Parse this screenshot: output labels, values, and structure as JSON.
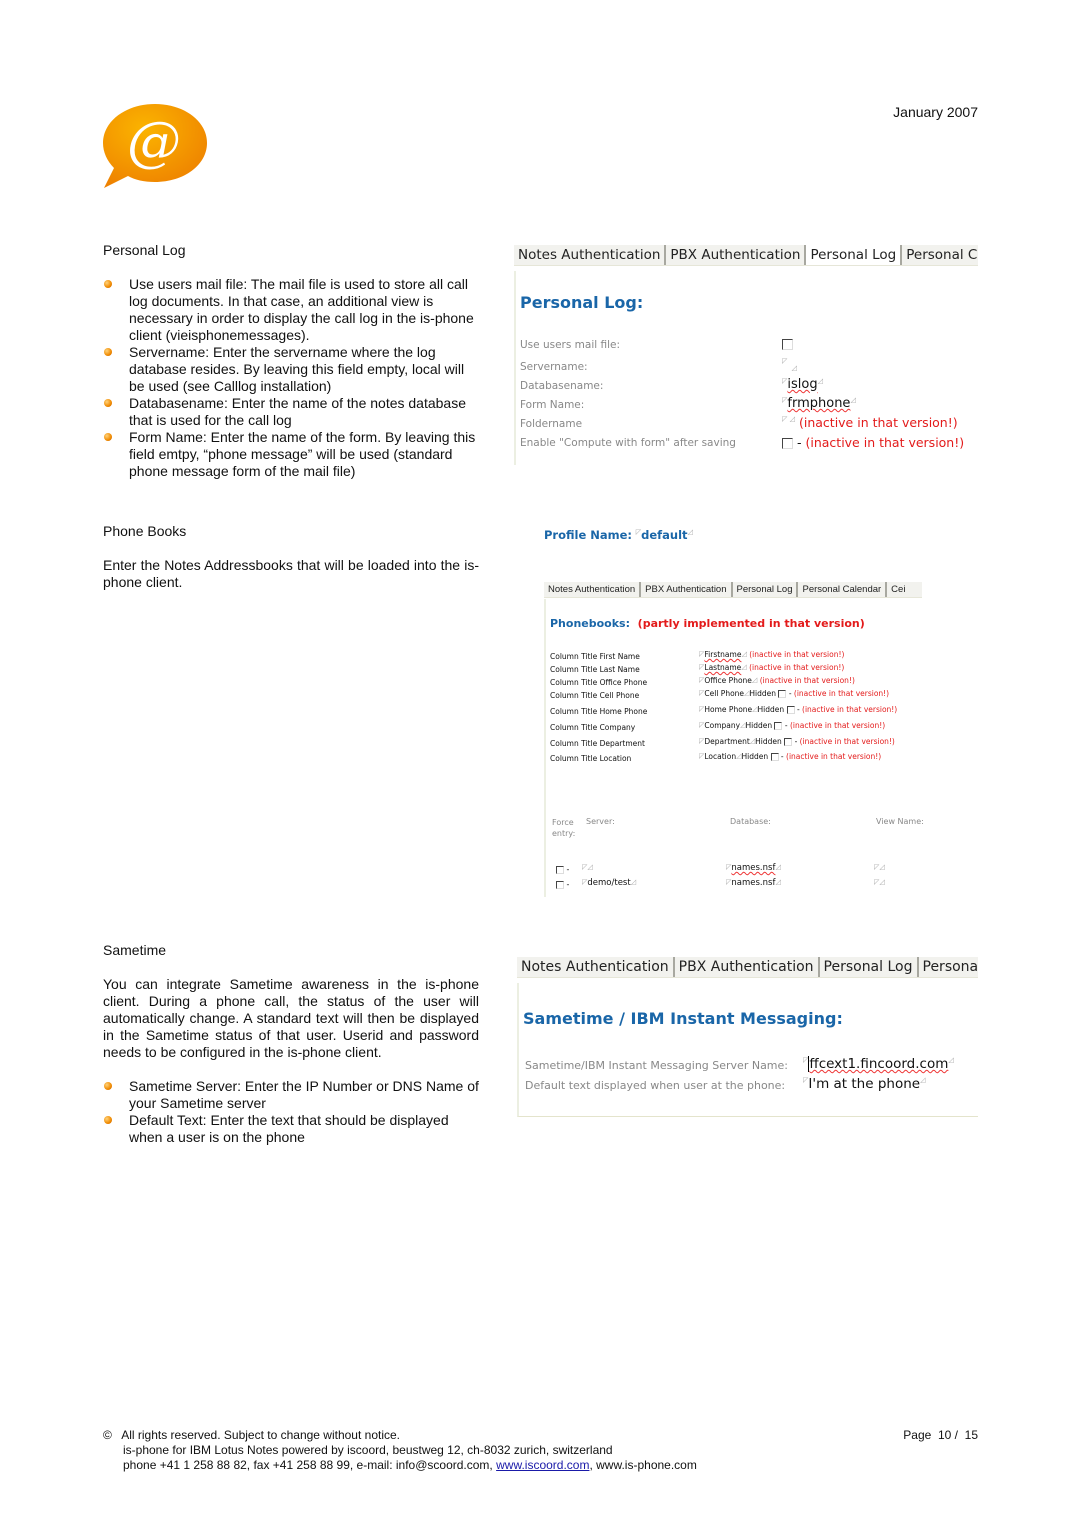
{
  "header": {
    "date": "January 2007",
    "logo_icon": "at-speech-bubble-icon",
    "logo_color": "#f39200"
  },
  "personal_log": {
    "heading": "Personal Log",
    "bullets": [
      "Use users mail file: The mail file is used to store all call log documents. In that case, an additional view is necessary in order to display the call log in the is-phone client (vieisphonemessages).",
      "Servername: Enter the servername where the log database resides. By leaving this field empty, local will be used (see Calllog installation)",
      "Databasename: Enter the name of the notes database that is used for the call log",
      "Form Name: Enter the name of the form. By leaving this field emtpy, “phone message” will be used (standard phone message form of the mail file)"
    ],
    "screenshot": {
      "tabs": [
        "Notes Authentication",
        "PBX Authentication",
        "Personal Log",
        "Personal Cale"
      ],
      "active_tab": 2,
      "title": "Personal Log:",
      "fields": [
        {
          "label": "Use users mail file:",
          "value": ""
        },
        {
          "label": "Servername:",
          "value": ""
        },
        {
          "label": "Databasename:",
          "value": "islog"
        },
        {
          "label": "Form Name:",
          "value": "frmphone"
        },
        {
          "label": "Foldername",
          "value": "",
          "note": "(inactive in that version!)"
        },
        {
          "label": "Enable \"Compute with form\" after saving",
          "value": "-",
          "note": "(inactive in that version!)"
        }
      ]
    }
  },
  "phone_books": {
    "heading": "Phone Books",
    "text": "Enter the Notes Addressbooks that will be loaded into the is-phone client.",
    "profile_label": "Profile Name:",
    "profile_value": "default",
    "screenshot": {
      "tabs": [
        "Notes Authentication",
        "PBX Authentication",
        "Personal Log",
        "Personal Calendar",
        "Cei"
      ],
      "title": "Phonebooks:",
      "title_note": "(partly implemented in that version)",
      "hidden_label": "Hidden",
      "note": "(inactive in that version!)",
      "columns": [
        {
          "label": "Column Title First Name",
          "value": "Firstname",
          "hidden": false
        },
        {
          "label": "Column Title Last Name",
          "value": "Lastname",
          "hidden": false
        },
        {
          "label": "Column Title Office Phone",
          "value": "Office Phone",
          "hidden": false
        },
        {
          "label": "Column Title Cell Phone",
          "value": "Cell Phone",
          "hidden": true
        },
        {
          "label": "Column Title Home Phone",
          "value": "Home Phone",
          "hidden": true
        },
        {
          "label": "Column Title Company",
          "value": "Company",
          "hidden": true
        },
        {
          "label": "Column Title Department",
          "value": "Department",
          "hidden": true
        },
        {
          "label": "Column Title Location",
          "value": "Location",
          "hidden": true
        }
      ],
      "table_headers": [
        "Force entry:",
        "Server:",
        "Database:",
        "View Name:"
      ],
      "table_rows": [
        {
          "server": "",
          "database": "names.nsf",
          "view": ""
        },
        {
          "server": "demo/test",
          "database": "names.nsf",
          "view": ""
        }
      ]
    }
  },
  "sametime": {
    "heading": "Sametime",
    "text": "You can integrate Sametime awareness in the is-phone client. During a phone call, the status of the user will automatically change. A standard text will then be displayed in the Sametime status of that user. Userid and password needs to be configured in the is-phone client.",
    "bullets": [
      "Sametime Server: Enter the IP Number or DNS Name of your Sametime server",
      "Default Text: Enter the text that should be displayed when a user is on the phone"
    ],
    "screenshot": {
      "tabs": [
        "Notes Authentication",
        "PBX Authentication",
        "Personal Log",
        "Persona"
      ],
      "title": "Sametime / IBM Instant Messaging:",
      "fields": [
        {
          "label": "Sametime/IBM Instant Messaging Server Name:",
          "value": "ffcext1.fincoord.com"
        },
        {
          "label": "Default text displayed when user at the phone:",
          "value": "I'm at the phone"
        }
      ]
    }
  },
  "footer": {
    "copyright_symbol": "©",
    "line1": "All rights reserved. Subject to change without notice.",
    "line2": "is-phone for IBM Lotus Notes powered by iscoord, beustweg 12, ch-8032 zurich, switzerland",
    "line3_prefix": "phone +41 1 258 88 82, fax +41 258 88 99, e-mail: info@scoord.com, ",
    "link": "www.iscoord.com",
    "line3_suffix": ", www.is-phone.com",
    "page": "Page  10 /  15"
  }
}
